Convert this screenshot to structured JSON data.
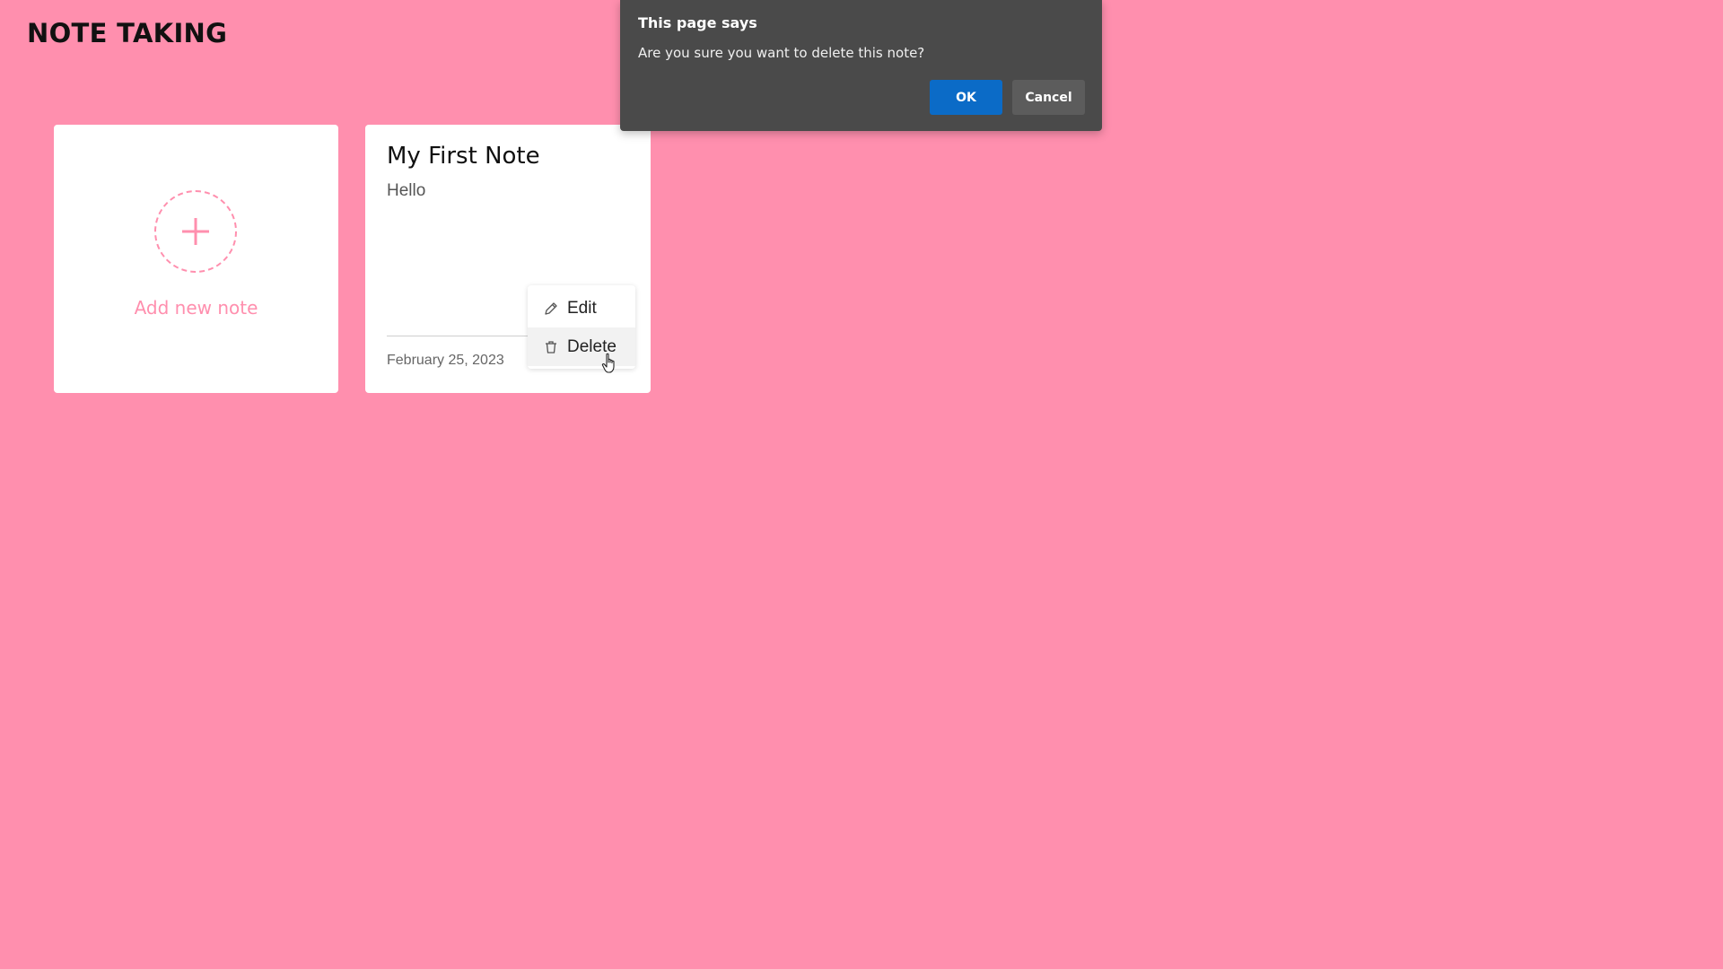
{
  "app": {
    "title": "NOTE TAKING"
  },
  "add_card": {
    "label": "Add new note",
    "icon": "plus-icon"
  },
  "notes": [
    {
      "title": "My First Note",
      "body": "Hello",
      "date": "February 25, 2023",
      "menu": [
        {
          "label": "Edit",
          "icon": "pencil-icon"
        },
        {
          "label": "Delete",
          "icon": "trash-icon"
        }
      ]
    }
  ],
  "dialog": {
    "title": "This page says",
    "message": "Are you sure you want to delete this note?",
    "ok_label": "OK",
    "cancel_label": "Cancel"
  },
  "colors": {
    "background": "#ff8fae",
    "accent": "#ff8fae",
    "dialog_bg": "#4a4a4a",
    "ok_button": "#0b6bc7",
    "cancel_button": "#5c5c5c"
  }
}
